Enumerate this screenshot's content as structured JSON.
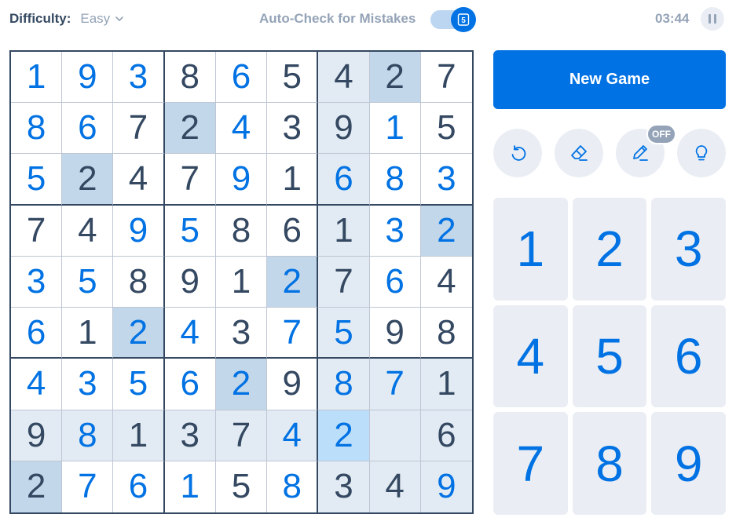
{
  "header": {
    "difficulty_label": "Difficulty:",
    "difficulty_value": "Easy",
    "autocheck_label": "Auto-Check for Mistakes",
    "autocheck_on": true,
    "autocheck_count": "5",
    "timer": "03:44"
  },
  "board": {
    "rows": [
      [
        "1",
        "9",
        "3",
        "8",
        "6",
        "5",
        "4",
        "2",
        "7"
      ],
      [
        "8",
        "6",
        "7",
        "2",
        "4",
        "3",
        "9",
        "1",
        "5"
      ],
      [
        "5",
        "2",
        "4",
        "7",
        "9",
        "1",
        "6",
        "8",
        "3"
      ],
      [
        "7",
        "4",
        "9",
        "5",
        "8",
        "6",
        "1",
        "3",
        "2"
      ],
      [
        "3",
        "5",
        "8",
        "9",
        "1",
        "2",
        "7",
        "6",
        "4"
      ],
      [
        "6",
        "1",
        "2",
        "4",
        "3",
        "7",
        "5",
        "9",
        "8"
      ],
      [
        "4",
        "3",
        "5",
        "6",
        "2",
        "9",
        "8",
        "7",
        "1"
      ],
      [
        "9",
        "8",
        "1",
        "3",
        "7",
        "4",
        "2",
        "",
        "6"
      ],
      [
        "2",
        "7",
        "6",
        "1",
        "5",
        "8",
        "3",
        "4",
        "9"
      ]
    ],
    "user_entered": [
      [
        0,
        0
      ],
      [
        0,
        1
      ],
      [
        0,
        2
      ],
      [
        0,
        4
      ],
      [
        1,
        0
      ],
      [
        1,
        1
      ],
      [
        1,
        4
      ],
      [
        1,
        7
      ],
      [
        2,
        0
      ],
      [
        2,
        4
      ],
      [
        2,
        6
      ],
      [
        2,
        7
      ],
      [
        2,
        8
      ],
      [
        3,
        2
      ],
      [
        3,
        3
      ],
      [
        3,
        7
      ],
      [
        3,
        8
      ],
      [
        4,
        0
      ],
      [
        4,
        1
      ],
      [
        4,
        5
      ],
      [
        4,
        7
      ],
      [
        5,
        0
      ],
      [
        5,
        2
      ],
      [
        5,
        3
      ],
      [
        5,
        5
      ],
      [
        5,
        6
      ],
      [
        6,
        0
      ],
      [
        6,
        1
      ],
      [
        6,
        2
      ],
      [
        6,
        3
      ],
      [
        6,
        4
      ],
      [
        6,
        6
      ],
      [
        6,
        7
      ],
      [
        7,
        1
      ],
      [
        7,
        5
      ],
      [
        7,
        6
      ],
      [
        8,
        1
      ],
      [
        8,
        2
      ],
      [
        8,
        3
      ],
      [
        8,
        5
      ],
      [
        8,
        8
      ]
    ],
    "selected": [
      7,
      6
    ],
    "same_number": [
      [
        0,
        7
      ],
      [
        1,
        3
      ],
      [
        2,
        1
      ],
      [
        3,
        8
      ],
      [
        4,
        5
      ],
      [
        5,
        2
      ],
      [
        6,
        4
      ],
      [
        8,
        0
      ]
    ]
  },
  "actions": {
    "new_game_label": "New Game",
    "notes_status": "OFF"
  },
  "numpad": [
    "1",
    "2",
    "3",
    "4",
    "5",
    "6",
    "7",
    "8",
    "9"
  ],
  "colors": {
    "accent": "#0072e3",
    "text": "#344861",
    "muted": "#94a3b7",
    "highlight_related": "#e2ebf3",
    "highlight_same": "#c3d7ea",
    "highlight_selected": "#bbdefb"
  },
  "icons": {
    "difficulty_dropdown": "chevron-down-icon",
    "undo": "undo-icon",
    "erase": "eraser-icon",
    "notes": "pencil-icon",
    "hint": "lightbulb-icon",
    "pause": "pause-icon"
  }
}
